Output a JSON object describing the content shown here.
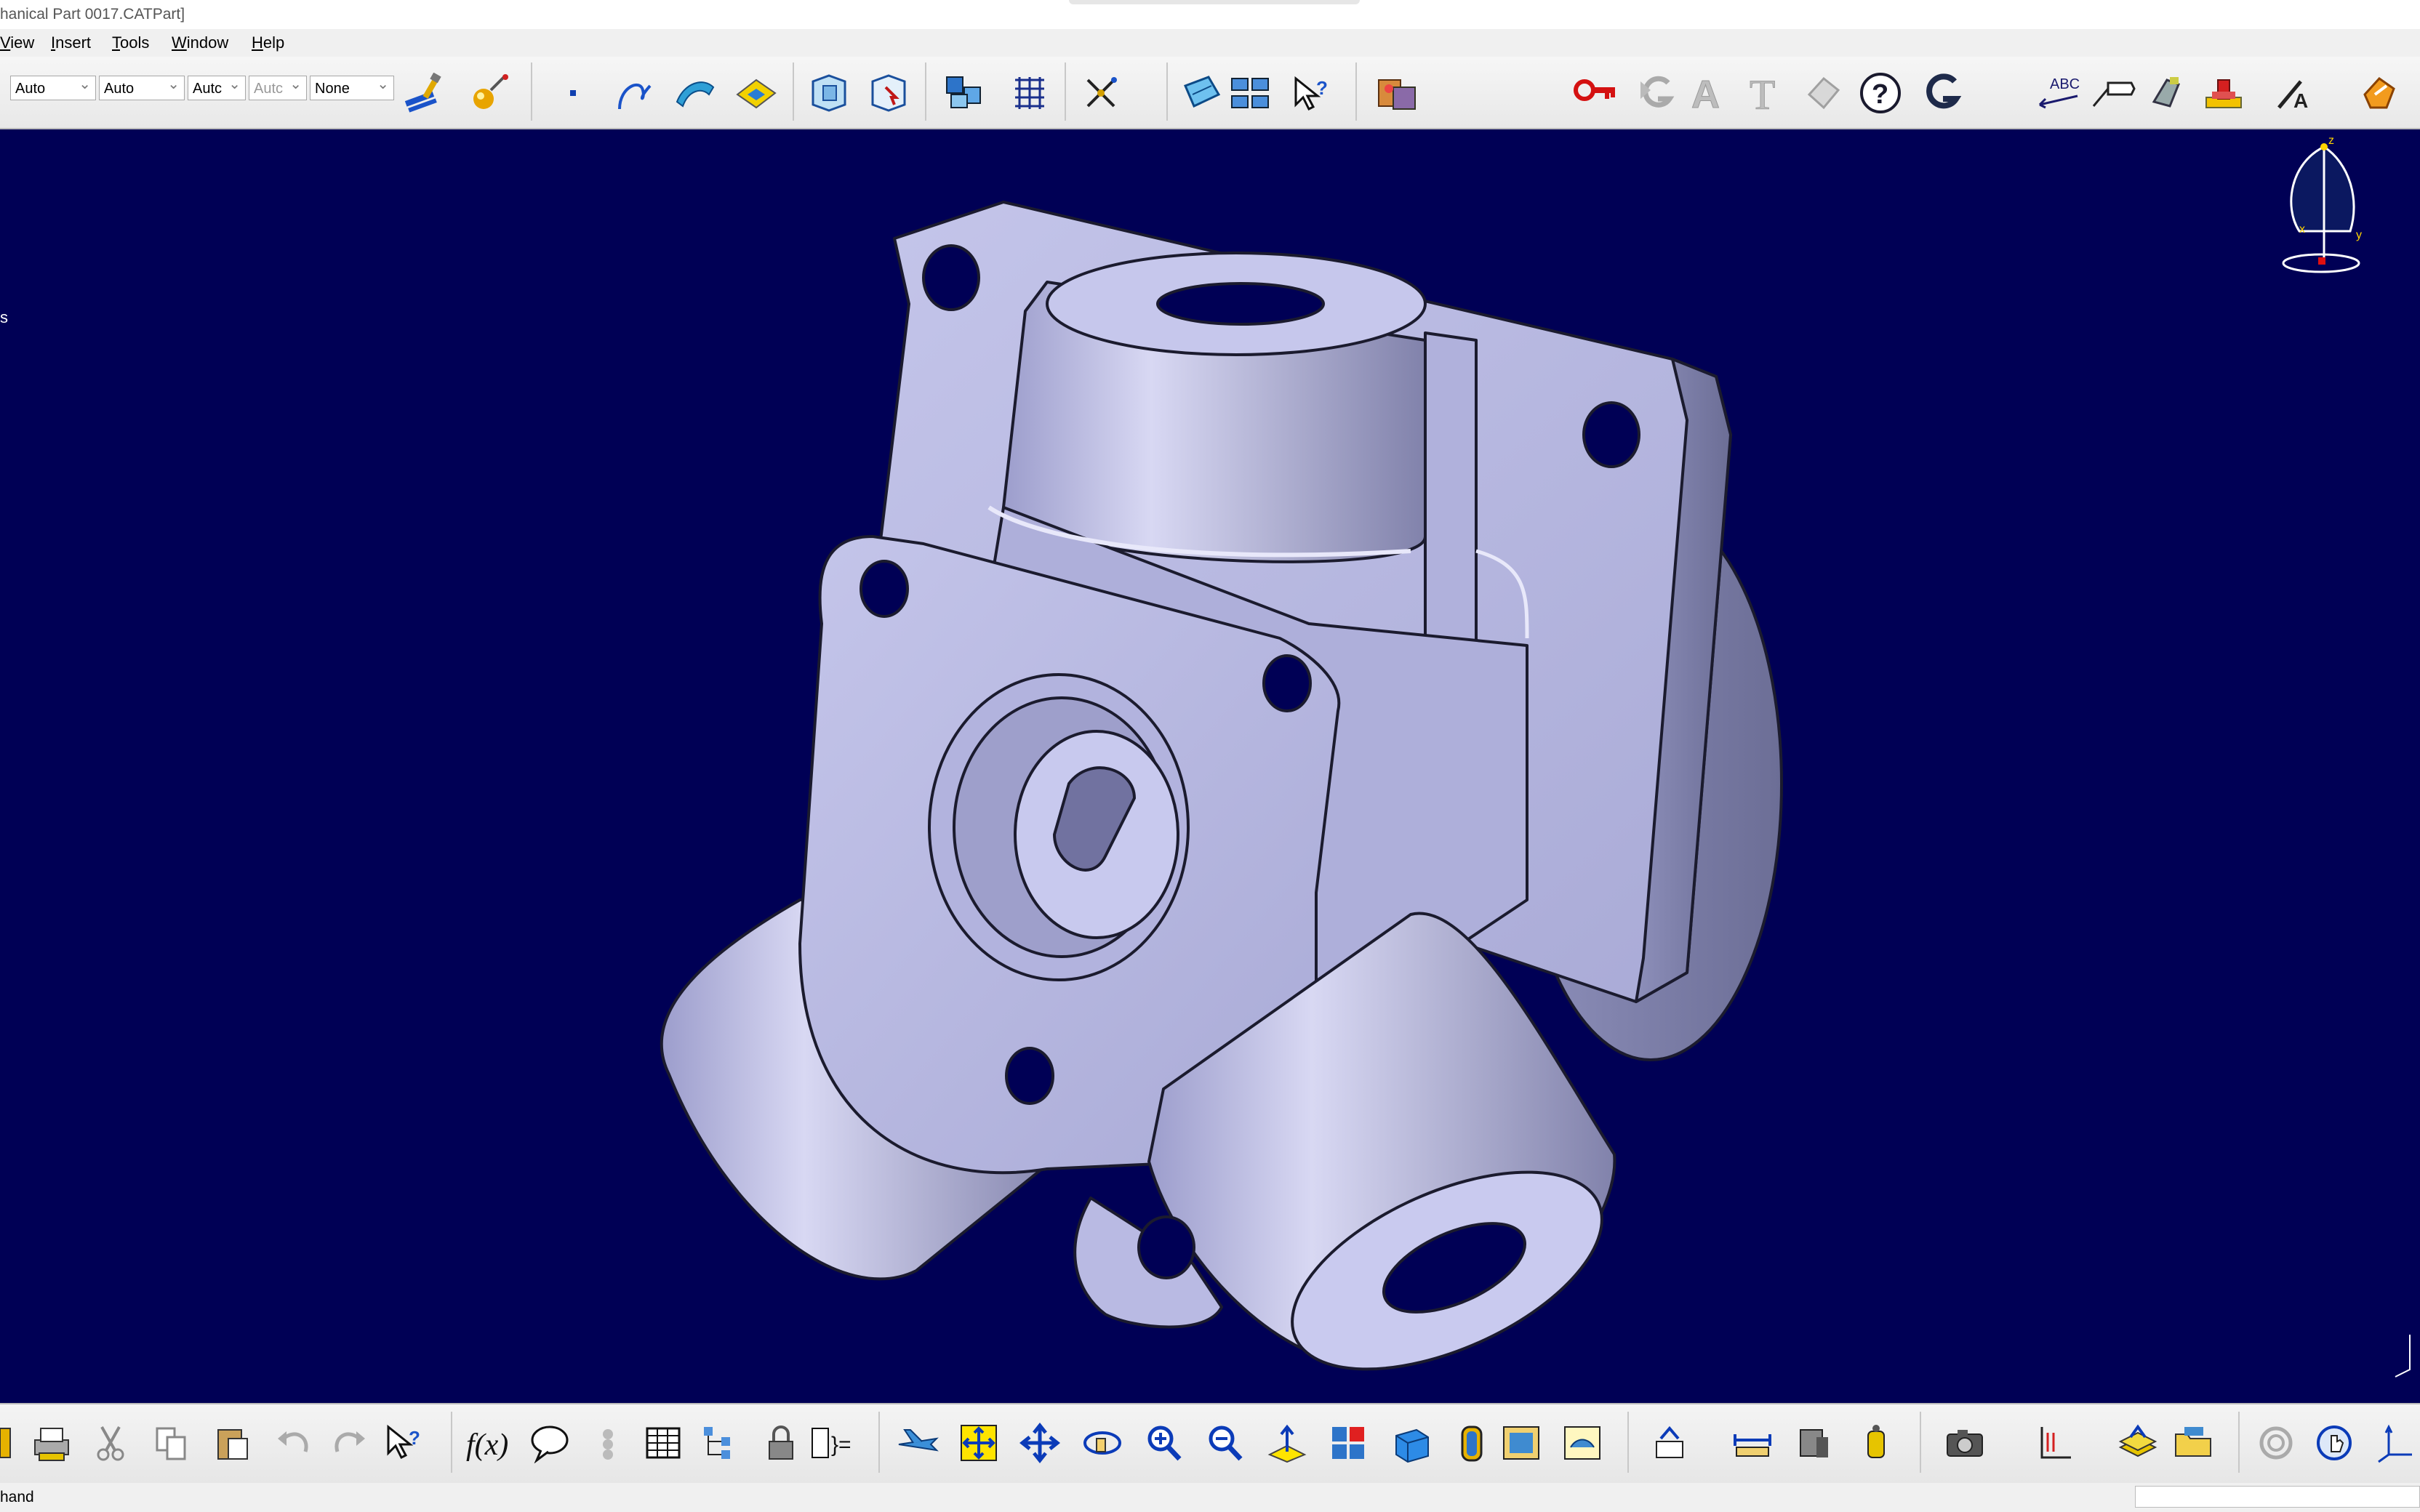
{
  "window": {
    "title": "hanical Part 0017.CATPart]"
  },
  "menu": {
    "items": [
      "View",
      "Insert",
      "Tools",
      "Window",
      "Help"
    ]
  },
  "toolbar_top": {
    "combos": [
      {
        "value": "Auto",
        "enabled": true
      },
      {
        "value": "Auto",
        "enabled": true
      },
      {
        "value": "Autc",
        "enabled": true
      },
      {
        "value": "Autc",
        "enabled": false
      },
      {
        "value": "None",
        "enabled": true
      }
    ],
    "icons": [
      "painter-icon",
      "graphic-properties-icon",
      "point-icon",
      "spline-icon",
      "surface-icon",
      "plane-icon",
      "part-body-icon",
      "body-select-icon",
      "product-icon",
      "grid-icon",
      "compass-snap-icon",
      "3d-view-icon",
      "catalog-icon",
      "what-is-icon",
      "material-icon",
      "lock-key-icon",
      "g-logo-icon",
      "text-a-icon",
      "text-t-icon",
      "eraser-icon",
      "help-icon",
      "app-g-icon",
      "spell-check-icon",
      "annotation-flag-icon",
      "annotation-hand-icon",
      "stamp-icon",
      "pen-icon",
      "manipulate-icon"
    ]
  },
  "viewport": {
    "background": "#000055",
    "tree_fragment": "s",
    "compass_axes": [
      "z",
      "x",
      "y"
    ]
  },
  "toolbar_bottom": {
    "icons": [
      "book-icon",
      "print-icon",
      "cut-icon",
      "copy-icon",
      "paste-icon",
      "undo-icon",
      "redo-icon",
      "whats-this-icon",
      "formula-icon",
      "comment-icon",
      "knowledge-icon",
      "table-icon",
      "tree-icon",
      "lock-icon",
      "params-icon",
      "fly-icon",
      "fit-all-icon",
      "pan-icon",
      "rotate-icon",
      "zoom-in-icon",
      "zoom-out-icon",
      "normal-view-icon",
      "multi-view-icon",
      "iso-view-icon",
      "shading-icon",
      "render-icon",
      "hide-show-icon",
      "swap-icon",
      "measure-icon",
      "measure-inertia-icon",
      "mass-icon",
      "capture-icon",
      "axis-system-icon",
      "layers-icon",
      "folder-icon",
      "refresh-icon",
      "hand-icon",
      "axis-icon"
    ]
  },
  "status": {
    "text": "hand"
  },
  "colors": {
    "part_fill": "#b8b9e2",
    "part_shadow": "#8d8eb5",
    "part_light": "#dcdcf4",
    "edge": "#1b1b2e"
  }
}
